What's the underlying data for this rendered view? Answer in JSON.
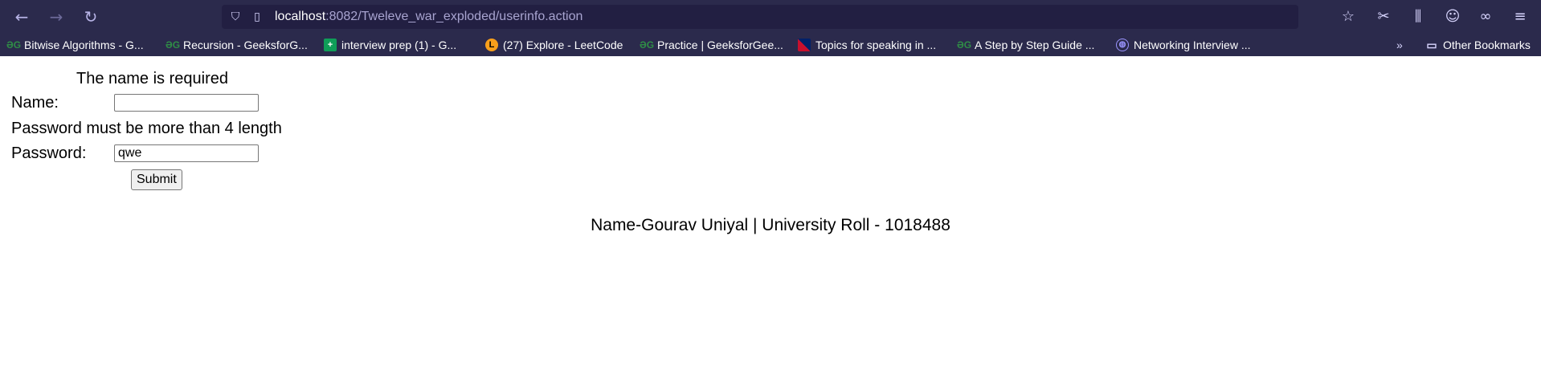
{
  "browser": {
    "url_host": "localhost",
    "url_rest": ":8082/Tweleve_war_exploded/userinfo.action",
    "bookmarks": [
      {
        "label": "Bitwise Algorithms - G...",
        "icon": "gfg-icon"
      },
      {
        "label": "Recursion - GeeksforG...",
        "icon": "gfg-icon"
      },
      {
        "label": "interview prep (1) - G...",
        "icon": "sheets-icon"
      },
      {
        "label": "(27) Explore - LeetCode",
        "icon": "leetcode-icon"
      },
      {
        "label": "Practice | GeeksforGee...",
        "icon": "gfg-icon"
      },
      {
        "label": "Topics for speaking in ...",
        "icon": "uk-flag-icon"
      },
      {
        "label": "A Step by Step Guide ...",
        "icon": "gfg-icon"
      },
      {
        "label": "Networking Interview ...",
        "icon": "globe-icon"
      }
    ],
    "other_bookmarks": "Other Bookmarks"
  },
  "form": {
    "name_error": "The name is required",
    "name_label": "Name:",
    "name_value": "",
    "password_error": "Password must be more than 4 length",
    "password_label": "Password:",
    "password_value": "qwe",
    "submit_label": "Submit"
  },
  "footer": {
    "text": "Name-Gourav Uniyal | University Roll - 1018488"
  }
}
